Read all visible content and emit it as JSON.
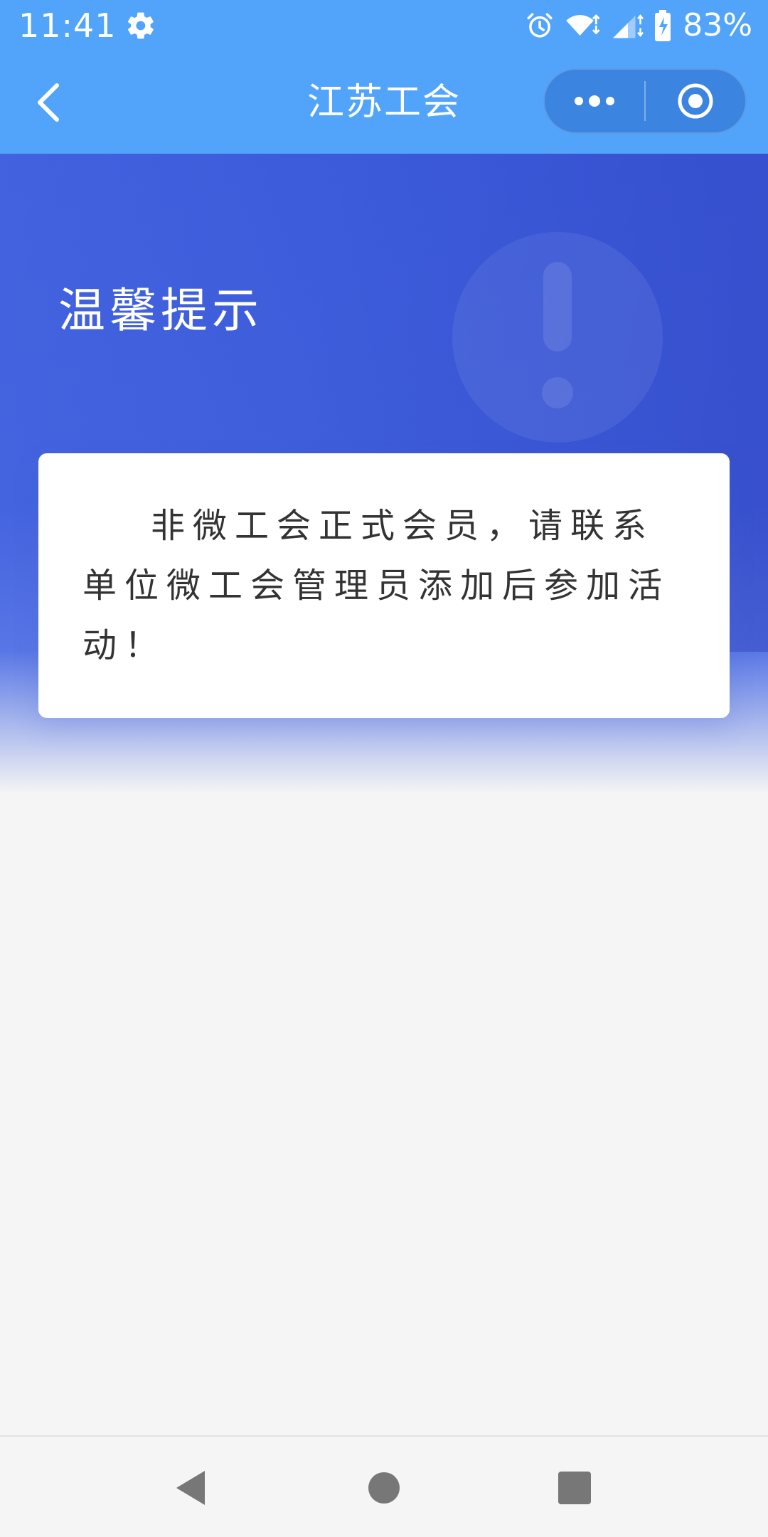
{
  "status_bar": {
    "time": "11:41",
    "battery_percent": "83%",
    "icons": [
      "gear-icon",
      "alarm-icon",
      "wifi-icon",
      "signal-icon",
      "battery-icon"
    ]
  },
  "title_bar": {
    "title": "江苏工会",
    "back_icon": "chevron-left-icon",
    "more_icon": "more-dots-icon",
    "close_icon": "target-close-icon"
  },
  "banner": {
    "heading": "温馨提示",
    "decor_icon": "exclamation-circle-icon"
  },
  "message": {
    "text": "非微工会正式会员，请联系单位微工会管理员添加后参加活动！"
  },
  "nav_bar": {
    "icons": [
      "nav-back-icon",
      "nav-home-icon",
      "nav-recents-icon"
    ]
  },
  "colors": {
    "header_blue": "#52a4fb",
    "banner_blue": "#3b5bdb",
    "card_text": "#333333",
    "page_background": "#f5f5f5"
  }
}
